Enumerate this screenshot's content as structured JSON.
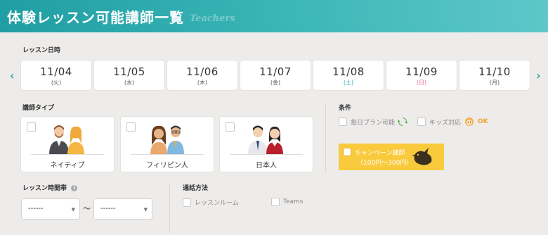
{
  "header": {
    "title": "体験レッスン可能講師一覧",
    "subtitle": "Teachers"
  },
  "lesson_date": {
    "label": "レッスン日時",
    "dates": [
      {
        "date": "11/04",
        "weekday": "(火)"
      },
      {
        "date": "11/05",
        "weekday": "(水)"
      },
      {
        "date": "11/06",
        "weekday": "(木)"
      },
      {
        "date": "11/07",
        "weekday": "(金)"
      },
      {
        "date": "11/08",
        "weekday": "(土)"
      },
      {
        "date": "11/09",
        "weekday": "(日)"
      },
      {
        "date": "11/10",
        "weekday": "(月)"
      }
    ],
    "prev_icon": "chevron-left-icon",
    "next_icon": "chevron-right-icon"
  },
  "teacher_type": {
    "label": "講師タイプ",
    "options": [
      {
        "label": "ネイティブ"
      },
      {
        "label": "フィリピン人"
      },
      {
        "label": "日本人"
      }
    ]
  },
  "conditions": {
    "label": "条件",
    "daily_plan": "毎日プラン可能",
    "kids": "キッズ対応",
    "kids_badge": "OK",
    "campaign_line1": "キャンペーン講師",
    "campaign_line2": "（100円〜300円）"
  },
  "lesson_time": {
    "label": "レッスン時間帯",
    "from": "------",
    "to": "------",
    "separator": "〜"
  },
  "call_method": {
    "label": "通話方法",
    "options": [
      "レッスンルーム",
      "Teams"
    ]
  },
  "colors": {
    "header_start": "#1f9ea3",
    "header_end": "#5ec7c8",
    "accent": "#2aa3a8",
    "campaign": "#f9ca3c",
    "saturday": "#2aa3c0",
    "sunday": "#e06a9a"
  }
}
